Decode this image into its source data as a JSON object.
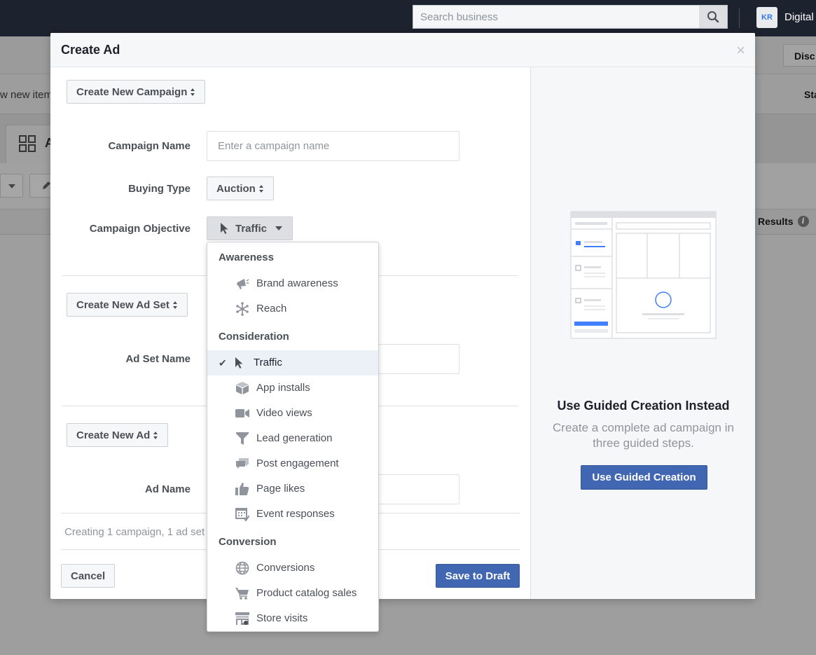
{
  "topbar": {
    "search_placeholder": "Search business",
    "avatar_initials": "KR",
    "account_name": "Digital"
  },
  "background": {
    "discard_label": "Disc",
    "review_text": "w new item",
    "status_header": "Sta",
    "tab_letter": "A",
    "results_header": "Results"
  },
  "modal": {
    "title": "Create Ad",
    "close_symbol": "×",
    "campaign_section": {
      "create_button": "Create New Campaign",
      "campaign_name_label": "Campaign Name",
      "campaign_name_placeholder": "Enter a campaign name",
      "campaign_name_value": "",
      "buying_type_label": "Buying Type",
      "buying_type_value": "Auction",
      "objective_label": "Campaign Objective",
      "objective_value": "Traffic"
    },
    "adset_section": {
      "create_button": "Create New Ad Set",
      "adset_name_label": "Ad Set Name"
    },
    "ad_section": {
      "create_button": "Create New Ad",
      "ad_name_label": "Ad Name"
    },
    "footer": {
      "note": "Creating 1 campaign, 1 ad set",
      "cancel_label": "Cancel",
      "save_label": "Save to Draft"
    },
    "guided": {
      "title": "Use Guided Creation Instead",
      "description": "Create a complete ad campaign in three guided steps.",
      "button_label": "Use Guided Creation"
    }
  },
  "objective_menu": {
    "groups": [
      {
        "label": "Awareness"
      },
      {
        "label": "Consideration"
      },
      {
        "label": "Conversion"
      }
    ],
    "items": [
      {
        "label": "Brand awareness",
        "icon": "megaphone-icon"
      },
      {
        "label": "Reach",
        "icon": "reach-icon"
      },
      {
        "label": "Traffic",
        "icon": "cursor-icon",
        "selected": true
      },
      {
        "label": "App installs",
        "icon": "box-icon"
      },
      {
        "label": "Video views",
        "icon": "video-camera-icon"
      },
      {
        "label": "Lead generation",
        "icon": "funnel-icon"
      },
      {
        "label": "Post engagement",
        "icon": "chat-bubbles-icon"
      },
      {
        "label": "Page likes",
        "icon": "thumbs-up-icon"
      },
      {
        "label": "Event responses",
        "icon": "calendar-icon"
      },
      {
        "label": "Conversions",
        "icon": "globe-icon"
      },
      {
        "label": "Product catalog sales",
        "icon": "cart-icon"
      },
      {
        "label": "Store visits",
        "icon": "store-icon"
      }
    ]
  },
  "colors": {
    "primary_button": "#4267b2",
    "topbar": "#1c222e",
    "selected_item_bg": "#ecf0f7"
  }
}
